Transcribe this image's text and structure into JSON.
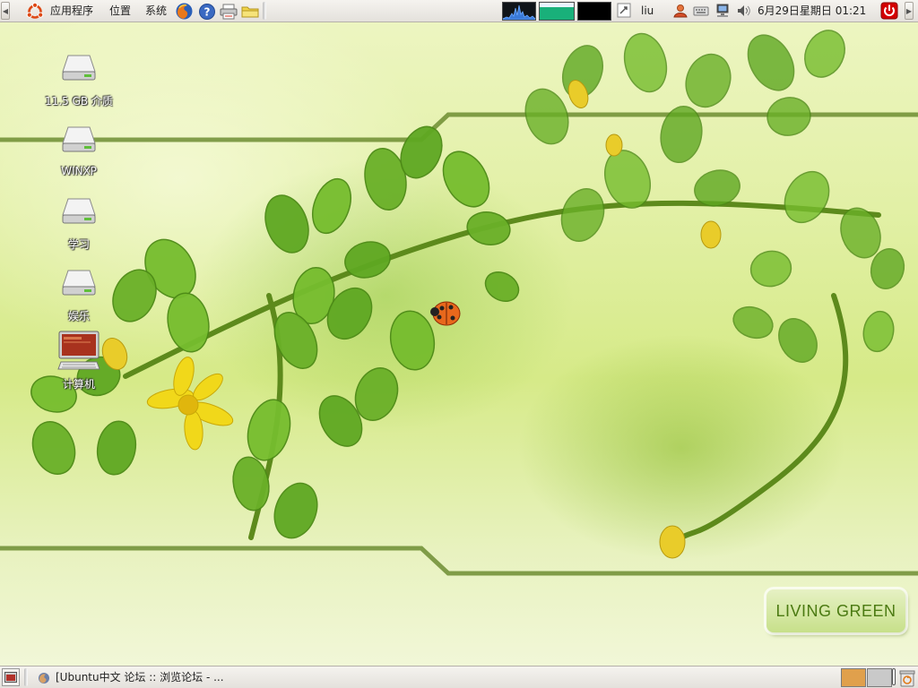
{
  "top_panel": {
    "menus": [
      "应用程序",
      "位置",
      "系统"
    ],
    "user": "liu",
    "clock": "6月29日星期日  01:21"
  },
  "desktop": {
    "icons": [
      {
        "label": "11.5 GB 介质",
        "icon": "drive-icon"
      },
      {
        "label": "WINXP",
        "icon": "drive-icon"
      },
      {
        "label": "学习",
        "icon": "drive-icon"
      },
      {
        "label": "娱乐",
        "icon": "drive-icon"
      },
      {
        "label": "计算机",
        "icon": "computer-icon"
      }
    ],
    "wallpaper_badge": "LIVING GREEN"
  },
  "bottom_panel": {
    "task": "[Ubuntu中文 论坛 :: 浏览论坛 - ..."
  },
  "colors": {
    "panel_bg": "#e9e7e2",
    "ubuntu_orange": "#dd4814",
    "logout_red": "#d40000",
    "living_green": "#4b7a12"
  }
}
